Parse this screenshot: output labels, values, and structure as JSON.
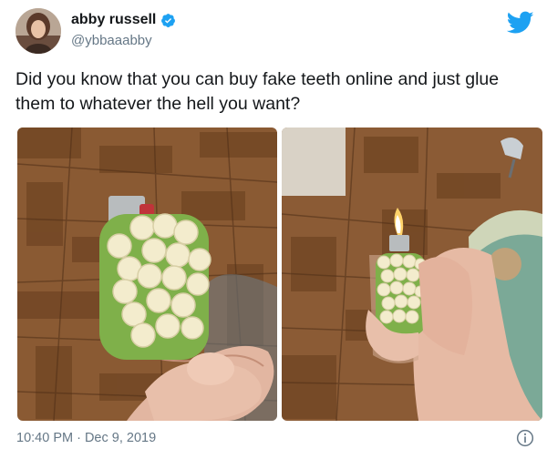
{
  "tweet": {
    "display_name": "abby russell",
    "handle": "@ybbaaabby",
    "verified_icon": "verified-badge-icon",
    "brand_icon": "twitter-bird-icon",
    "text": "Did you know that you can buy fake teeth online and just glue them to whatever the hell you want?",
    "timestamp": "10:40 PM · Dec 9, 2019",
    "info_icon": "info-icon"
  },
  "colors": {
    "twitter_blue": "#1da1f2",
    "secondary_text": "#657786",
    "primary_text": "#14171a"
  },
  "media": [
    {
      "name": "left-photo",
      "depicts": "teeth-covered lighter held in hand"
    },
    {
      "name": "right-photo",
      "depicts": "teeth-covered lighter lit with flame"
    }
  ]
}
